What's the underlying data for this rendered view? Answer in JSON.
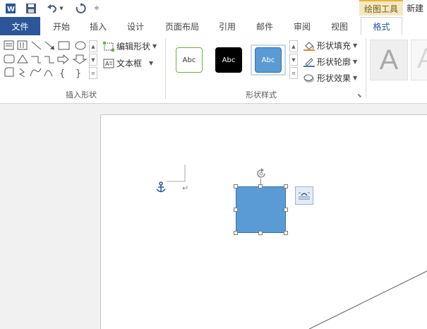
{
  "quick_access": {
    "app_icon": "word-icon",
    "save_icon": "save-icon",
    "undo_icon": "undo-icon",
    "redo_icon": "redo-icon",
    "customize_icon": "customize-quick-access-icon"
  },
  "context_tab_group": {
    "label": "绘图工具",
    "new_label": "新建"
  },
  "tabs": {
    "file": "文件",
    "home": "开始",
    "insert": "插入",
    "design": "设计",
    "layout": "页面布局",
    "references": "引用",
    "mailings": "邮件",
    "review": "审阅",
    "view": "视图",
    "format": "格式"
  },
  "active_tab": "格式",
  "ribbon": {
    "insert_shapes": {
      "group_label": "插入形状",
      "edit_shape_label": "编辑形状",
      "text_box_label": "文本框"
    },
    "shape_styles": {
      "group_label": "形状样式",
      "styles": [
        {
          "label": "Abc",
          "fill": "#ffffff",
          "border": "#70ad47",
          "text": "#333333"
        },
        {
          "label": "Abc",
          "fill": "#000000",
          "border": "#000000",
          "text": "#ffffff"
        },
        {
          "label": "Abc",
          "fill": "#5b9bd5",
          "border": "#41719c",
          "text": "#ffffff"
        }
      ],
      "shape_fill_label": "形状填充",
      "shape_outline_label": "形状轮廓",
      "shape_effects_label": "形状效果"
    },
    "wordart_styles": {
      "sample_label": "A"
    }
  },
  "document": {
    "shape_fill_color": "#5b9bd5",
    "anchor_icon": "anchor-icon",
    "paragraph_mark": "↵",
    "layout_options_icon": "layout-options-icon"
  },
  "colors": {
    "file_tab_bg": "#2b579a",
    "accent": "#2b579a",
    "context_group_bg": "#f3e9c2"
  }
}
